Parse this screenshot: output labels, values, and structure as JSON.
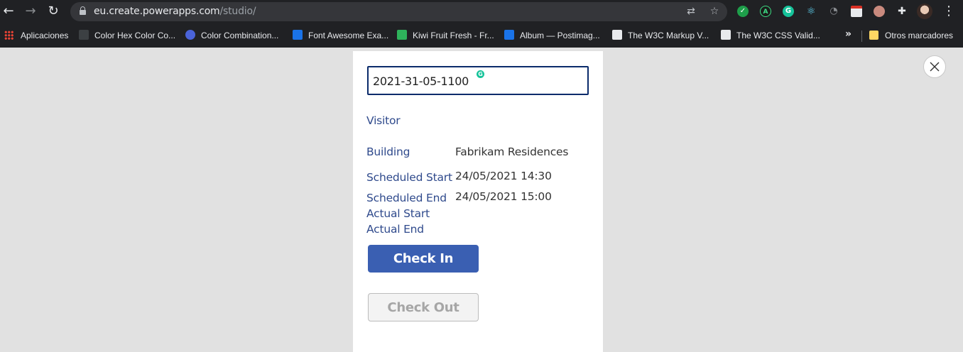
{
  "browser": {
    "url_domain": "eu.create.powerapps.com",
    "url_path": "/studio/",
    "extension_icons": [
      "check-extension-icon",
      "acrobat-extension-icon",
      "grammarly-extension-icon",
      "react-devtools-icon",
      "timer-extension-icon",
      "calendar-extension-icon",
      "cookie-extension-icon",
      "puzzle-extensions-icon"
    ]
  },
  "bookmarks": {
    "items": [
      {
        "label": "Aplicaciones",
        "icon": "apps-grid-icon"
      },
      {
        "label": "Color Hex Color Co...",
        "icon": "colorhex-icon"
      },
      {
        "label": "Color Combination...",
        "icon": "colorcombo-icon"
      },
      {
        "label": "Font Awesome Exa...",
        "icon": "flag-icon"
      },
      {
        "label": "Kiwi Fruit Fresh - Fr...",
        "icon": "px-icon"
      },
      {
        "label": "Album — Postimag...",
        "icon": "postimage-icon"
      },
      {
        "label": "The W3C Markup V...",
        "icon": "w3c-icon"
      },
      {
        "label": "The W3C CSS Valid...",
        "icon": "w3c-css-icon"
      }
    ],
    "more": "»",
    "other_folder": "Otros marcadores"
  },
  "form": {
    "id_value": "2021-31-05-1100",
    "visitor_label": "Visitor",
    "fields": [
      {
        "label": "Building",
        "value": "Fabrikam Residences"
      },
      {
        "label": "Scheduled Start",
        "value": "24/05/2021 14:30"
      },
      {
        "label": "Scheduled End",
        "value": "24/05/2021 15:00"
      },
      {
        "label": "Actual Start",
        "value": ""
      },
      {
        "label": "Actual End",
        "value": ""
      }
    ],
    "checkin_label": "Check In",
    "checkout_label": "Check Out"
  },
  "colors": {
    "label_blue": "#2f4a8c",
    "primary_button": "#3a5fb2",
    "input_border": "#0b2b6b",
    "canvas_bg": "#e1e1e1"
  }
}
